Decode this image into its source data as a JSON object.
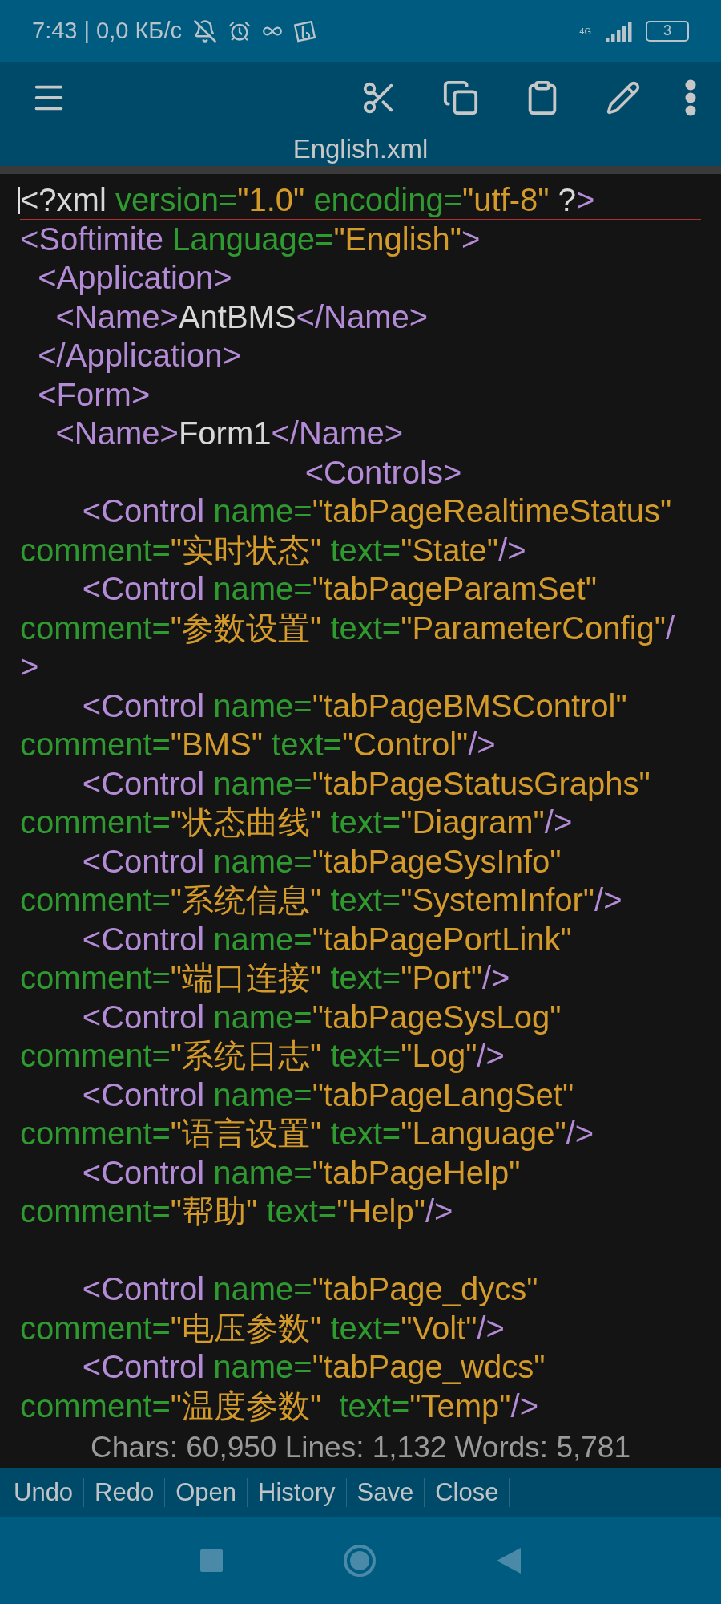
{
  "status_bar": {
    "time": "7:43 | 0,0 КБ/с",
    "network": "4G",
    "battery": "3"
  },
  "title": "English.xml",
  "editor": {
    "lines": [
      {
        "cursor": true,
        "tokens": [
          {
            "kind": "plain",
            "text": "<?xml "
          },
          {
            "kind": "attr",
            "text": "version="
          },
          {
            "kind": "value",
            "text": "\"1.0\" "
          },
          {
            "kind": "attr",
            "text": "encoding="
          },
          {
            "kind": "value",
            "text": "\"utf-8\" "
          },
          {
            "kind": "plain",
            "text": "?"
          },
          {
            "kind": "tag",
            "text": ">"
          }
        ]
      },
      {
        "cursor": false,
        "tokens": [
          {
            "kind": "tag",
            "text": "<Softimite "
          },
          {
            "kind": "attr",
            "text": "Language="
          },
          {
            "kind": "value",
            "text": "\"English\""
          },
          {
            "kind": "tag",
            "text": ">"
          }
        ]
      },
      {
        "cursor": false,
        "tokens": [
          {
            "kind": "tag",
            "text": "  <Application>"
          }
        ]
      },
      {
        "cursor": false,
        "tokens": [
          {
            "kind": "tag",
            "text": "    <Name>"
          },
          {
            "kind": "plain",
            "text": "AntBMS"
          },
          {
            "kind": "tag",
            "text": "</Name>"
          }
        ]
      },
      {
        "cursor": false,
        "tokens": [
          {
            "kind": "tag",
            "text": "  </Application>"
          }
        ]
      },
      {
        "cursor": false,
        "tokens": [
          {
            "kind": "tag",
            "text": "  <Form>"
          }
        ]
      },
      {
        "cursor": false,
        "tokens": [
          {
            "kind": "tag",
            "text": "    <Name>"
          },
          {
            "kind": "plain",
            "text": "Form1"
          },
          {
            "kind": "tag",
            "text": "</Name>"
          }
        ]
      },
      {
        "cursor": false,
        "tokens": [
          {
            "kind": "tag",
            "text": "                                <Controls>"
          }
        ]
      },
      {
        "cursor": false,
        "tokens": [
          {
            "kind": "tag",
            "text": "       <Control "
          },
          {
            "kind": "attr",
            "text": "name="
          },
          {
            "kind": "value",
            "text": "\"tabPageRealtimeStatus\""
          }
        ]
      },
      {
        "cursor": false,
        "tokens": [
          {
            "kind": "attr",
            "text": "comment="
          },
          {
            "kind": "value",
            "text": "\"实时状态\" "
          },
          {
            "kind": "attr",
            "text": "text="
          },
          {
            "kind": "value",
            "text": "\"State\""
          },
          {
            "kind": "tag",
            "text": "/>"
          }
        ]
      },
      {
        "cursor": false,
        "tokens": [
          {
            "kind": "tag",
            "text": "       <Control "
          },
          {
            "kind": "attr",
            "text": "name="
          },
          {
            "kind": "value",
            "text": "\"tabPageParamSet\""
          }
        ]
      },
      {
        "cursor": false,
        "tokens": [
          {
            "kind": "attr",
            "text": "comment="
          },
          {
            "kind": "value",
            "text": "\"参数设置\" "
          },
          {
            "kind": "attr",
            "text": "text="
          },
          {
            "kind": "value",
            "text": "\"ParameterConfig\""
          },
          {
            "kind": "tag",
            "text": "/"
          }
        ]
      },
      {
        "cursor": false,
        "tokens": [
          {
            "kind": "tag",
            "text": ">"
          }
        ]
      },
      {
        "cursor": false,
        "tokens": [
          {
            "kind": "tag",
            "text": "       <Control "
          },
          {
            "kind": "attr",
            "text": "name="
          },
          {
            "kind": "value",
            "text": "\"tabPageBMSControl\""
          }
        ]
      },
      {
        "cursor": false,
        "tokens": [
          {
            "kind": "attr",
            "text": "comment="
          },
          {
            "kind": "value",
            "text": "\"BMS\" "
          },
          {
            "kind": "attr",
            "text": "text="
          },
          {
            "kind": "value",
            "text": "\"Control\""
          },
          {
            "kind": "tag",
            "text": "/>"
          }
        ]
      },
      {
        "cursor": false,
        "tokens": [
          {
            "kind": "tag",
            "text": "       <Control "
          },
          {
            "kind": "attr",
            "text": "name="
          },
          {
            "kind": "value",
            "text": "\"tabPageStatusGraphs\""
          }
        ]
      },
      {
        "cursor": false,
        "tokens": [
          {
            "kind": "attr",
            "text": "comment="
          },
          {
            "kind": "value",
            "text": "\"状态曲线\" "
          },
          {
            "kind": "attr",
            "text": "text="
          },
          {
            "kind": "value",
            "text": "\"Diagram\""
          },
          {
            "kind": "tag",
            "text": "/>"
          }
        ]
      },
      {
        "cursor": false,
        "tokens": [
          {
            "kind": "tag",
            "text": "       <Control "
          },
          {
            "kind": "attr",
            "text": "name="
          },
          {
            "kind": "value",
            "text": "\"tabPageSysInfo\""
          }
        ]
      },
      {
        "cursor": false,
        "tokens": [
          {
            "kind": "attr",
            "text": "comment="
          },
          {
            "kind": "value",
            "text": "\"系统信息\" "
          },
          {
            "kind": "attr",
            "text": "text="
          },
          {
            "kind": "value",
            "text": "\"SystemInfor\""
          },
          {
            "kind": "tag",
            "text": "/>"
          }
        ]
      },
      {
        "cursor": false,
        "tokens": [
          {
            "kind": "tag",
            "text": "       <Control "
          },
          {
            "kind": "attr",
            "text": "name="
          },
          {
            "kind": "value",
            "text": "\"tabPagePortLink\""
          }
        ]
      },
      {
        "cursor": false,
        "tokens": [
          {
            "kind": "attr",
            "text": "comment="
          },
          {
            "kind": "value",
            "text": "\"端口连接\" "
          },
          {
            "kind": "attr",
            "text": "text="
          },
          {
            "kind": "value",
            "text": "\"Port\""
          },
          {
            "kind": "tag",
            "text": "/>"
          }
        ]
      },
      {
        "cursor": false,
        "tokens": [
          {
            "kind": "tag",
            "text": "       <Control "
          },
          {
            "kind": "attr",
            "text": "name="
          },
          {
            "kind": "value",
            "text": "\"tabPageSysLog\""
          }
        ]
      },
      {
        "cursor": false,
        "tokens": [
          {
            "kind": "attr",
            "text": "comment="
          },
          {
            "kind": "value",
            "text": "\"系统日志\" "
          },
          {
            "kind": "attr",
            "text": "text="
          },
          {
            "kind": "value",
            "text": "\"Log\""
          },
          {
            "kind": "tag",
            "text": "/>"
          }
        ]
      },
      {
        "cursor": false,
        "tokens": [
          {
            "kind": "tag",
            "text": "       <Control "
          },
          {
            "kind": "attr",
            "text": "name="
          },
          {
            "kind": "value",
            "text": "\"tabPageLangSet\""
          }
        ]
      },
      {
        "cursor": false,
        "tokens": [
          {
            "kind": "attr",
            "text": "comment="
          },
          {
            "kind": "value",
            "text": "\"语言设置\" "
          },
          {
            "kind": "attr",
            "text": "text="
          },
          {
            "kind": "value",
            "text": "\"Language\""
          },
          {
            "kind": "tag",
            "text": "/>"
          }
        ]
      },
      {
        "cursor": false,
        "tokens": [
          {
            "kind": "tag",
            "text": "       <Control "
          },
          {
            "kind": "attr",
            "text": "name="
          },
          {
            "kind": "value",
            "text": "\"tabPageHelp\""
          }
        ]
      },
      {
        "cursor": false,
        "tokens": [
          {
            "kind": "attr",
            "text": "comment="
          },
          {
            "kind": "value",
            "text": "\"帮助\" "
          },
          {
            "kind": "attr",
            "text": "text="
          },
          {
            "kind": "value",
            "text": "\"Help\""
          },
          {
            "kind": "tag",
            "text": "/>"
          }
        ]
      },
      {
        "cursor": false
      },
      {
        "cursor": false,
        "tokens": [
          {
            "kind": "tag",
            "text": "       <Control "
          },
          {
            "kind": "attr",
            "text": "name="
          },
          {
            "kind": "value",
            "text": "\"tabPage_dycs\""
          }
        ]
      },
      {
        "cursor": false,
        "tokens": [
          {
            "kind": "attr",
            "text": "comment="
          },
          {
            "kind": "value",
            "text": "\"电压参数\" "
          },
          {
            "kind": "attr",
            "text": "text="
          },
          {
            "kind": "value",
            "text": "\"Volt\""
          },
          {
            "kind": "tag",
            "text": "/>"
          }
        ]
      },
      {
        "cursor": false,
        "tokens": [
          {
            "kind": "tag",
            "text": "       <Control "
          },
          {
            "kind": "attr",
            "text": "name="
          },
          {
            "kind": "value",
            "text": "\"tabPage_wdcs\""
          }
        ]
      },
      {
        "cursor": false,
        "tokens": [
          {
            "kind": "attr",
            "text": "comment="
          },
          {
            "kind": "value",
            "text": "\"温度参数\"  "
          },
          {
            "kind": "attr",
            "text": "text="
          },
          {
            "kind": "value",
            "text": "\"Temp\""
          },
          {
            "kind": "tag",
            "text": "/>"
          }
        ]
      }
    ],
    "stats": "Chars: 60,950  Lines: 1,132  Words: 5,781"
  },
  "actions": [
    "Undo",
    "Redo",
    "Open",
    "History",
    "Save",
    "Close"
  ]
}
